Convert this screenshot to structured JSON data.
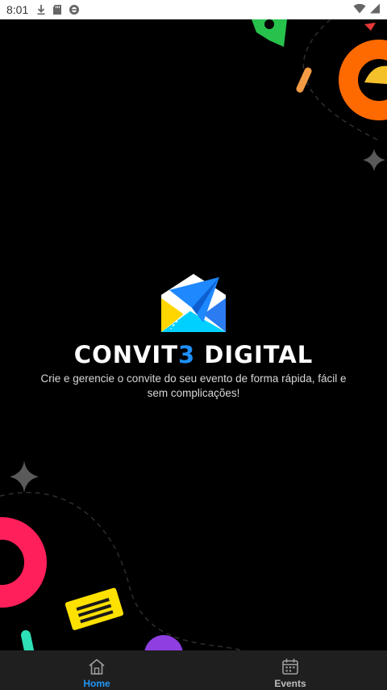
{
  "status_bar": {
    "time": "8:01",
    "icons": [
      "download-icon",
      "sd-card-icon",
      "sync-icon"
    ],
    "right_icons": [
      "wifi-icon",
      "signal-icon"
    ]
  },
  "brand": {
    "name_part1": "CONVIT",
    "name_accent": "3",
    "name_part2": " DIGITAL",
    "tagline": "Crie e gerencie o convite do seu evento de forma rápida, fácil e sem complicações!"
  },
  "bottom_nav": {
    "items": [
      {
        "label": "Home",
        "icon": "home-icon",
        "active": true
      },
      {
        "label": "Events",
        "icon": "calendar-icon",
        "active": false
      }
    ]
  },
  "colors": {
    "accent": "#2196f3",
    "background": "#000000",
    "nav_background": "#1f1f1f"
  }
}
